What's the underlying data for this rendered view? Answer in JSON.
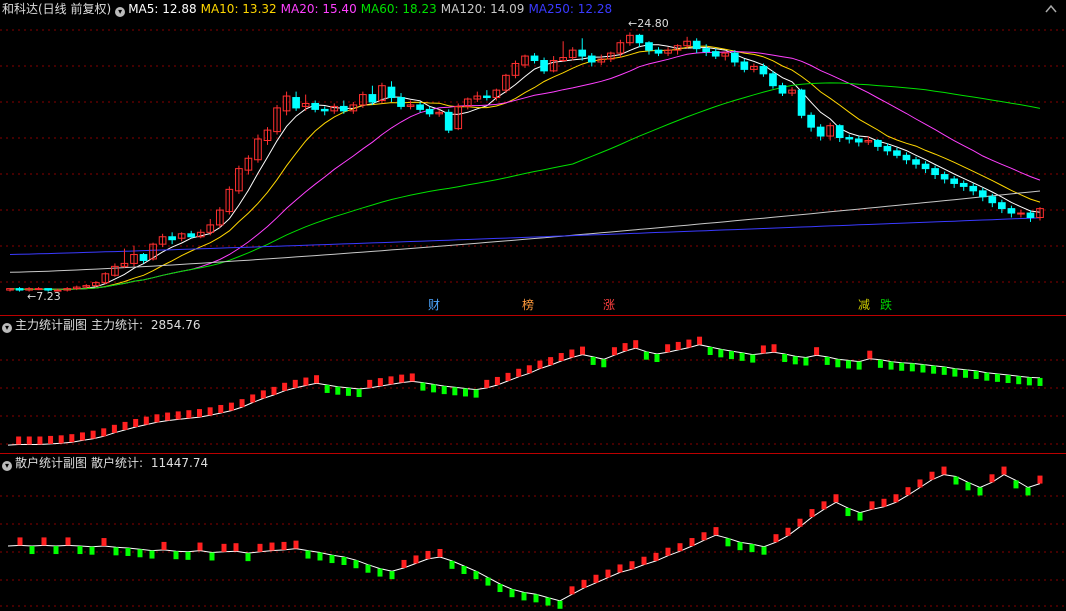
{
  "main": {
    "title": "和科达(日线 前复权)",
    "ma": [
      {
        "label": "MA5: 12.88",
        "color": "#ffffff"
      },
      {
        "label": "MA10: 13.32",
        "color": "#ffd700"
      },
      {
        "label": "MA20: 15.40",
        "color": "#ff40ff"
      },
      {
        "label": "MA60: 18.23",
        "color": "#00e000"
      },
      {
        "label": "MA120: 14.09",
        "color": "#c8c8c8"
      },
      {
        "label": "MA250: 12.28",
        "color": "#3a3aff"
      }
    ],
    "high_label": "24.80",
    "low_label": "7.23",
    "events": [
      {
        "text": "财",
        "color": "#4da6ff"
      },
      {
        "text": "榜",
        "color": "#ff9a3c"
      },
      {
        "text": "涨",
        "color": "#ff4040"
      },
      {
        "text": "减",
        "color": "#cccc00"
      },
      {
        "text": "跌",
        "color": "#00d000"
      }
    ]
  },
  "sub1": {
    "title": "主力统计副图",
    "stat_label": "主力统计: ",
    "stat_value": "2854.76"
  },
  "sub2": {
    "title": "散户统计副图",
    "stat_label": "散户统计: ",
    "stat_value": "11447.74"
  },
  "colors": {
    "up": "#ff3030",
    "down": "#00ffff",
    "bar_up": "#ff2020",
    "bar_down": "#00ff00",
    "grid": "#880000"
  },
  "chart_data": {
    "type": "candlestick",
    "price_high": 24.8,
    "price_low": 7.23,
    "candles": [
      [
        7.4,
        7.5,
        7.5,
        7.3
      ],
      [
        7.5,
        7.4,
        7.6,
        7.3
      ],
      [
        7.4,
        7.5,
        7.6,
        7.3
      ],
      [
        7.5,
        7.5,
        7.6,
        7.4
      ],
      [
        7.5,
        7.4,
        7.5,
        7.3
      ],
      [
        7.4,
        7.4,
        7.5,
        7.3
      ],
      [
        7.4,
        7.5,
        7.6,
        7.3
      ],
      [
        7.5,
        7.6,
        7.7,
        7.4
      ],
      [
        7.6,
        7.7,
        7.8,
        7.5
      ],
      [
        7.7,
        7.9,
        8.0,
        7.6
      ],
      [
        7.9,
        8.5,
        8.6,
        7.8
      ],
      [
        8.4,
        9.0,
        9.2,
        8.3
      ],
      [
        9.0,
        9.2,
        10.2,
        8.9
      ],
      [
        9.2,
        9.8,
        10.4,
        9.0
      ],
      [
        9.8,
        9.4,
        9.9,
        9.2
      ],
      [
        9.5,
        10.5,
        10.6,
        9.4
      ],
      [
        10.5,
        11.0,
        11.2,
        10.3
      ],
      [
        11.0,
        10.8,
        11.3,
        10.5
      ],
      [
        10.9,
        11.2,
        11.3,
        10.7
      ],
      [
        11.2,
        11.0,
        11.4,
        10.9
      ],
      [
        11.0,
        11.3,
        11.5,
        10.9
      ],
      [
        11.3,
        11.8,
        12.2,
        11.1
      ],
      [
        11.8,
        12.8,
        13.0,
        11.6
      ],
      [
        12.7,
        14.2,
        14.4,
        12.5
      ],
      [
        14.1,
        15.6,
        15.8,
        13.9
      ],
      [
        15.5,
        16.3,
        16.5,
        15.2
      ],
      [
        16.2,
        17.6,
        17.9,
        16.0
      ],
      [
        17.5,
        18.2,
        18.4,
        17.2
      ],
      [
        18.1,
        19.7,
        19.9,
        17.9
      ],
      [
        19.5,
        20.5,
        20.8,
        19.2
      ],
      [
        20.4,
        19.7,
        20.8,
        19.5
      ],
      [
        19.8,
        20.0,
        20.6,
        19.5
      ],
      [
        20.0,
        19.6,
        20.2,
        19.4
      ],
      [
        19.6,
        19.5,
        19.8,
        19.2
      ],
      [
        19.5,
        19.8,
        20.0,
        19.3
      ],
      [
        19.8,
        19.5,
        20.2,
        19.3
      ],
      [
        19.5,
        19.9,
        20.1,
        19.3
      ],
      [
        19.9,
        20.6,
        20.8,
        19.7
      ],
      [
        20.6,
        20.1,
        21.2,
        19.9
      ],
      [
        20.2,
        21.2,
        21.4,
        20.0
      ],
      [
        21.1,
        20.4,
        21.5,
        20.1
      ],
      [
        20.4,
        19.8,
        20.7,
        19.6
      ],
      [
        19.8,
        19.9,
        20.2,
        19.6
      ],
      [
        19.9,
        19.6,
        20.1,
        19.4
      ],
      [
        19.6,
        19.3,
        19.8,
        19.1
      ],
      [
        19.3,
        19.4,
        19.6,
        19.1
      ],
      [
        19.4,
        18.2,
        19.6,
        18.0
      ],
      [
        18.3,
        19.8,
        20.0,
        18.2
      ],
      [
        19.8,
        20.3,
        20.4,
        19.6
      ],
      [
        20.3,
        20.5,
        20.8,
        20.1
      ],
      [
        20.5,
        20.4,
        20.9,
        20.2
      ],
      [
        20.4,
        20.9,
        21.0,
        20.2
      ],
      [
        20.9,
        21.9,
        22.0,
        20.7
      ],
      [
        21.9,
        22.7,
        22.9,
        21.7
      ],
      [
        22.6,
        23.2,
        23.3,
        22.4
      ],
      [
        23.2,
        22.9,
        23.4,
        22.7
      ],
      [
        22.9,
        22.2,
        23.1,
        22.0
      ],
      [
        22.2,
        22.9,
        23.2,
        22.1
      ],
      [
        22.9,
        23.1,
        24.2,
        22.8
      ],
      [
        23.1,
        23.6,
        23.8,
        22.9
      ],
      [
        23.6,
        23.2,
        24.4,
        22.9
      ],
      [
        23.2,
        22.8,
        23.4,
        22.5
      ],
      [
        22.8,
        23.0,
        23.3,
        22.6
      ],
      [
        23.0,
        23.4,
        23.5,
        22.8
      ],
      [
        23.4,
        24.1,
        24.3,
        23.1
      ],
      [
        24.1,
        24.6,
        24.8,
        23.9
      ],
      [
        24.6,
        24.1,
        24.7,
        23.8
      ],
      [
        24.1,
        23.6,
        24.2,
        23.3
      ],
      [
        23.6,
        23.4,
        23.8,
        23.2
      ],
      [
        23.4,
        23.6,
        23.8,
        23.2
      ],
      [
        23.6,
        23.9,
        24.0,
        23.3
      ],
      [
        23.9,
        24.2,
        24.5,
        23.7
      ],
      [
        24.2,
        23.7,
        24.4,
        23.4
      ],
      [
        23.7,
        23.5,
        24.0,
        23.2
      ],
      [
        23.5,
        23.2,
        23.7,
        23.0
      ],
      [
        23.2,
        23.4,
        23.5,
        22.9
      ],
      [
        23.4,
        22.8,
        23.6,
        22.5
      ],
      [
        22.8,
        22.3,
        23.0,
        22.1
      ],
      [
        22.3,
        22.5,
        22.7,
        22.1
      ],
      [
        22.5,
        22.0,
        22.7,
        21.8
      ],
      [
        22.0,
        21.2,
        22.2,
        21.0
      ],
      [
        21.2,
        20.7,
        21.4,
        20.5
      ],
      [
        20.7,
        20.9,
        21.1,
        20.5
      ],
      [
        20.9,
        19.2,
        21.0,
        19.0
      ],
      [
        19.2,
        18.4,
        19.4,
        18.1
      ],
      [
        18.4,
        17.8,
        18.6,
        17.5
      ],
      [
        17.8,
        18.5,
        18.7,
        17.5
      ],
      [
        18.5,
        17.7,
        18.6,
        17.4
      ],
      [
        17.7,
        17.6,
        17.9,
        17.3
      ],
      [
        17.6,
        17.4,
        17.8,
        17.1
      ],
      [
        17.4,
        17.5,
        17.8,
        17.2
      ],
      [
        17.5,
        17.1,
        17.6,
        16.8
      ],
      [
        17.1,
        16.8,
        17.3,
        16.5
      ],
      [
        16.8,
        16.5,
        17.0,
        16.3
      ],
      [
        16.5,
        16.2,
        16.7,
        15.9
      ],
      [
        16.2,
        15.9,
        16.4,
        15.6
      ],
      [
        15.9,
        15.6,
        16.1,
        15.3
      ],
      [
        15.6,
        15.2,
        15.8,
        14.9
      ],
      [
        15.2,
        14.9,
        15.4,
        14.6
      ],
      [
        14.9,
        14.6,
        15.1,
        14.3
      ],
      [
        14.6,
        14.4,
        14.8,
        14.1
      ],
      [
        14.4,
        14.1,
        14.6,
        13.8
      ],
      [
        14.1,
        13.7,
        14.3,
        13.4
      ],
      [
        13.7,
        13.3,
        13.9,
        13.0
      ],
      [
        13.3,
        12.9,
        13.5,
        12.6
      ],
      [
        12.9,
        12.6,
        13.1,
        12.3
      ],
      [
        12.6,
        12.6,
        12.8,
        12.3
      ],
      [
        12.6,
        12.3,
        12.8,
        12.0
      ],
      [
        12.3,
        12.9,
        13.0,
        12.1
      ]
    ],
    "sub1_values": [
      3.5,
      3.6,
      3.6,
      3.6,
      3.7,
      3.8,
      4.0,
      4.3,
      4.6,
      5.0,
      5.6,
      6.1,
      6.6,
      7.0,
      7.4,
      7.7,
      7.9,
      8.1,
      8.3,
      8.6,
      9.0,
      9.4,
      10.0,
      10.8,
      11.5,
      12.1,
      12.8,
      13.3,
      13.7,
      14.1,
      13.8,
      13.5,
      13.3,
      13.1,
      13.3,
      13.6,
      13.9,
      14.2,
      14.4,
      14.2,
      13.9,
      13.6,
      13.4,
      13.2,
      13.0,
      13.3,
      13.8,
      14.5,
      15.2,
      15.8,
      16.6,
      17.2,
      17.9,
      18.5,
      19.0,
      18.6,
      18.2,
      18.9,
      19.6,
      20.1,
      19.5,
      19.1,
      19.4,
      19.8,
      20.2,
      20.7,
      20.3,
      19.9,
      19.6,
      19.3,
      19.0,
      19.2,
      19.4,
      19.1,
      18.7,
      18.5,
      18.9,
      18.6,
      18.2,
      18.0,
      17.8,
      18.3,
      18.1,
      17.8,
      17.6,
      17.5,
      17.3,
      17.1,
      16.9,
      16.6,
      16.4,
      16.2,
      15.9,
      15.7,
      15.5,
      15.3,
      15.1,
      15.0
    ],
    "sub2_values": [
      9.5,
      9.6,
      9.5,
      9.6,
      9.5,
      9.6,
      9.5,
      9.4,
      9.5,
      9.3,
      9.2,
      9.0,
      8.8,
      8.9,
      8.7,
      8.6,
      8.8,
      8.5,
      8.6,
      8.7,
      8.4,
      8.6,
      8.8,
      8.9,
      9.1,
      8.8,
      8.5,
      8.1,
      7.8,
      7.3,
      6.6,
      6.0,
      5.6,
      6.1,
      6.8,
      7.5,
      7.8,
      7.2,
      6.4,
      5.6,
      4.6,
      3.6,
      2.8,
      2.3,
      2.0,
      1.5,
      1.0,
      2.0,
      3.0,
      3.8,
      4.6,
      5.4,
      5.9,
      6.6,
      7.2,
      8.0,
      8.7,
      9.5,
      10.4,
      11.2,
      10.7,
      10.1,
      9.8,
      9.4,
      10.1,
      11.1,
      12.5,
      14.0,
      15.2,
      16.3,
      15.4,
      14.7,
      15.2,
      15.6,
      16.3,
      17.4,
      18.6,
      19.8,
      20.6,
      20.3,
      19.4,
      18.6,
      19.4,
      20.6,
      19.7,
      18.6,
      19.2
    ]
  }
}
